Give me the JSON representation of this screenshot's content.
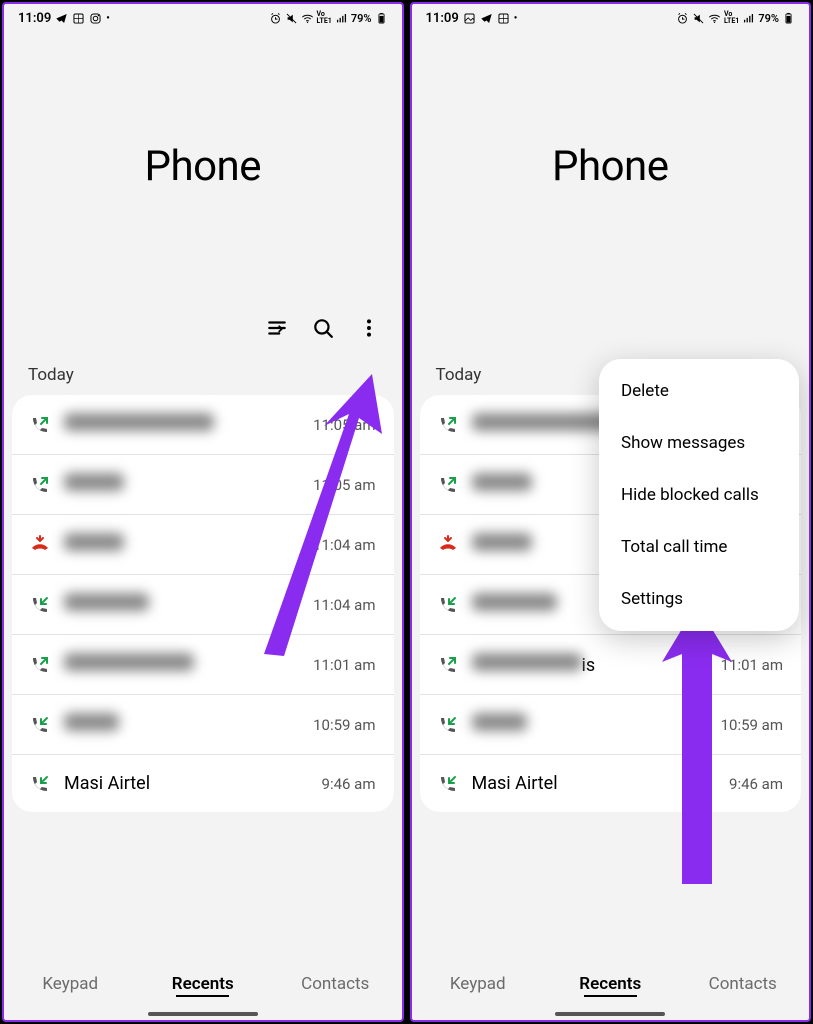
{
  "status": {
    "time": "11:09",
    "battery": "79%",
    "icons_left_1": [
      "telegram-icon",
      "gallery-icon",
      "instagram-icon"
    ],
    "icons_left_2": [
      "image-icon",
      "gallery-icon"
    ],
    "icons_right": [
      "alarm-icon",
      "mute-icon",
      "wifi-icon",
      "volte-icon",
      "signal-icon"
    ]
  },
  "app": {
    "title": "Phone"
  },
  "section": {
    "today": "Today"
  },
  "calls": [
    {
      "type": "out",
      "name_blurred": true,
      "name_w": 150,
      "name": "",
      "time": "11:05 am"
    },
    {
      "type": "out",
      "name_blurred": true,
      "name_w": 60,
      "name": "",
      "time": "11:05 am"
    },
    {
      "type": "missed",
      "name_blurred": true,
      "name_w": 60,
      "name": "",
      "time": "11:04 am"
    },
    {
      "type": "in",
      "name_blurred": true,
      "name_w": 85,
      "name": "",
      "time": "11:04 am"
    },
    {
      "type": "out",
      "name_blurred": true,
      "name_w": 130,
      "name": "",
      "time": "11:01 am",
      "suffix_r": "is"
    },
    {
      "type": "in",
      "name_blurred": true,
      "name_w": 55,
      "name": "",
      "time": "10:59 am"
    },
    {
      "type": "in",
      "name_blurred": false,
      "name": "Masi Airtel",
      "time": "9:46 am"
    }
  ],
  "tabs": {
    "keypad": "Keypad",
    "recents": "Recents",
    "contacts": "Contacts"
  },
  "menu": {
    "delete": "Delete",
    "show_messages": "Show messages",
    "hide_blocked": "Hide blocked calls",
    "total_call_time": "Total call time",
    "settings": "Settings"
  }
}
